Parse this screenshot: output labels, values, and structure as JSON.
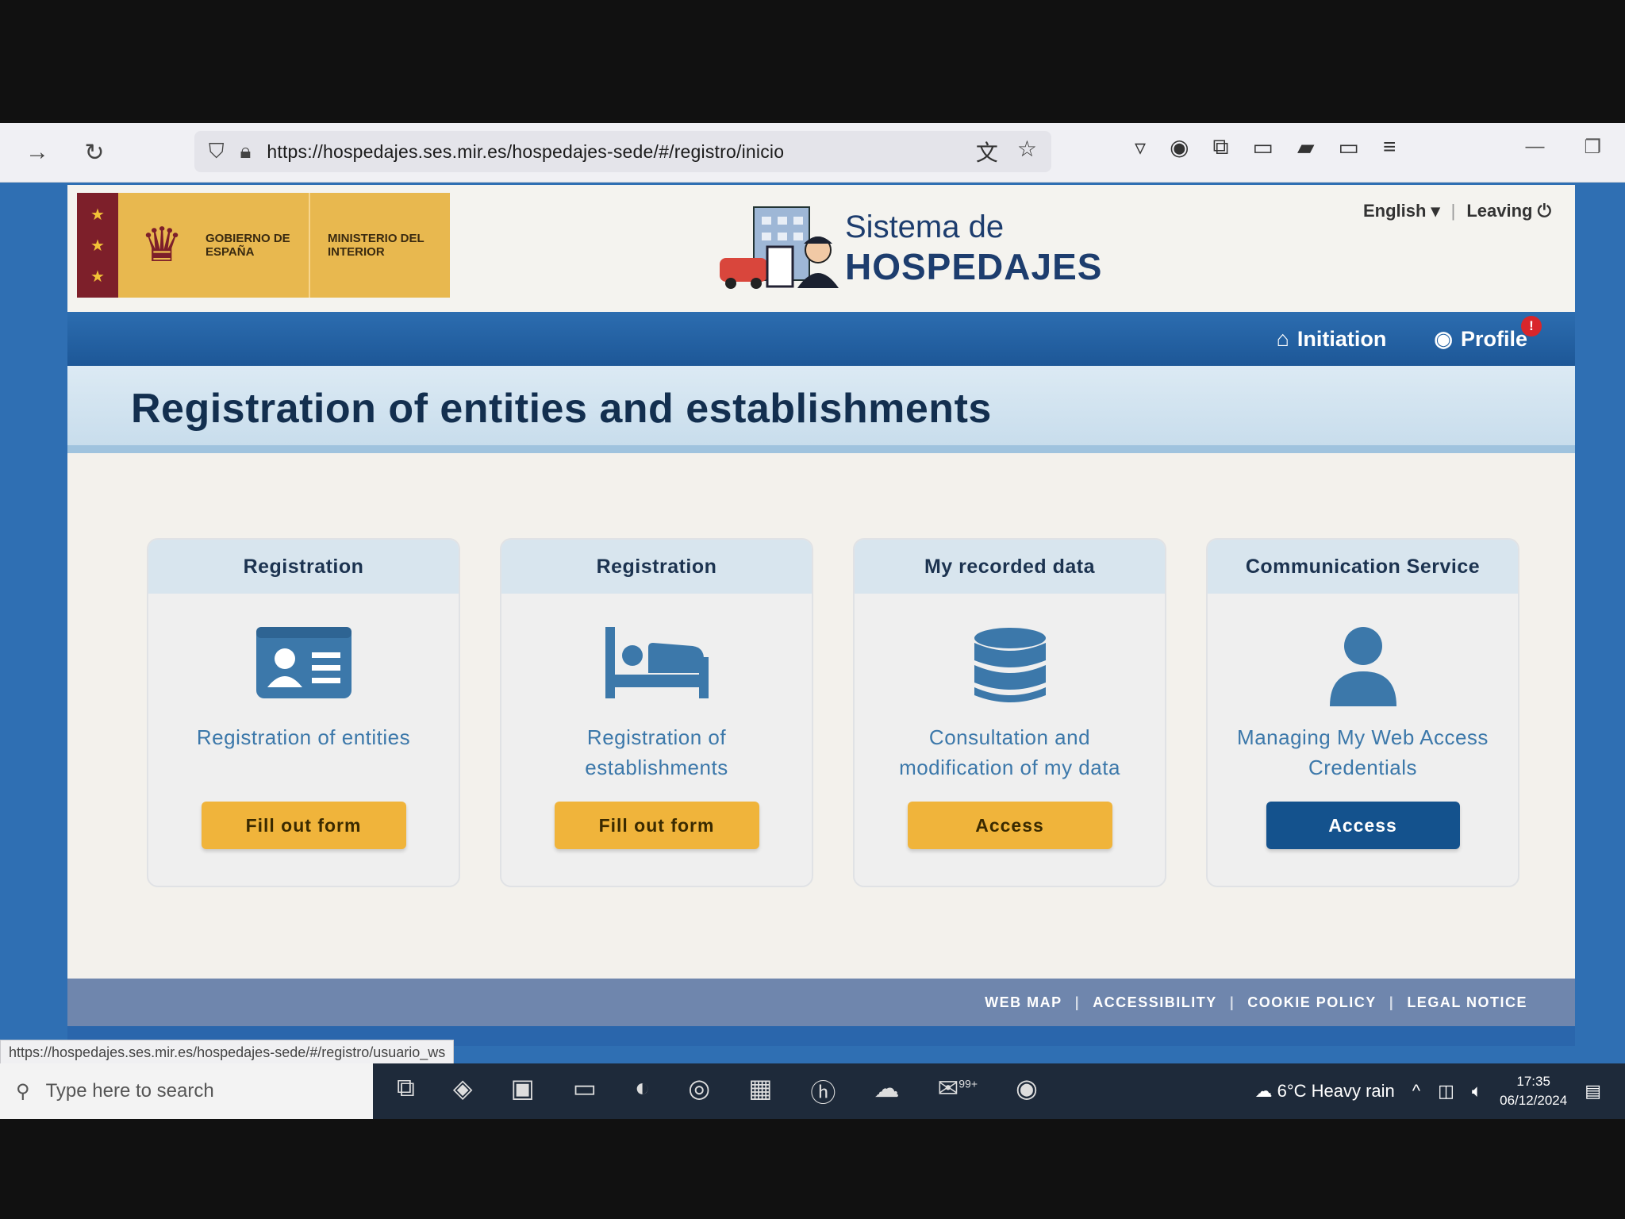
{
  "browser": {
    "url": "https://hospedajes.ses.mir.es/hospedajes-sede/#/registro/inicio",
    "status_url": "https://hospedajes.ses.mir.es/hospedajes-sede/#/registro/usuario_ws"
  },
  "header": {
    "gov_text_1": "GOBIERNO DE ESPAÑA",
    "gov_text_2": "MINISTERIO DEL INTERIOR",
    "brand_line_1": "Sistema de",
    "brand_line_2": "HOSPEDAJES",
    "language": "English",
    "leaving": "Leaving"
  },
  "nav": {
    "initiation": "Initiation",
    "profile": "Profile",
    "profile_badge": "!"
  },
  "page_title": "Registration of entities and establishments",
  "cards": [
    {
      "title": "Registration",
      "icon": "id-card-icon",
      "desc": "Registration of entities",
      "button": "Fill out form"
    },
    {
      "title": "Registration",
      "icon": "bed-icon",
      "desc": "Registration of establishments",
      "button": "Fill out form"
    },
    {
      "title": "My recorded data",
      "icon": "database-icon",
      "desc": "Consultation and modification of my data",
      "button": "Access"
    },
    {
      "title": "Communication Service",
      "icon": "user-icon",
      "desc": "Managing My Web Access Credentials",
      "button": "Access"
    }
  ],
  "footer": {
    "web_map": "WEB MAP",
    "accessibility": "ACCESSIBILITY",
    "cookie_policy": "COOKIE POLICY",
    "legal_notice": "LEGAL NOTICE"
  },
  "taskbar": {
    "search_placeholder": "Type here to search",
    "mail_badge": "99+",
    "weather": "6°C  Heavy rain",
    "time": "17:35",
    "date": "06/12/2024"
  },
  "colors": {
    "nav_blue": "#1d5797",
    "button_orange": "#f0b43b",
    "button_blue": "#14528d",
    "title_navy": "#132f4f"
  }
}
